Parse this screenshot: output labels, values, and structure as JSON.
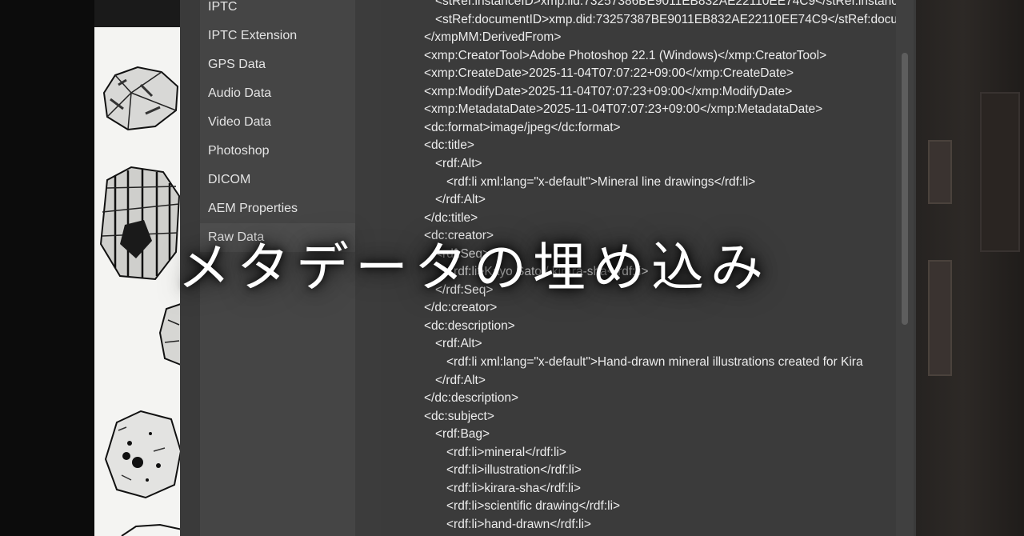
{
  "caption": "メタデータの埋め込み",
  "sidebar": {
    "items": [
      {
        "label": "IPTC"
      },
      {
        "label": "IPTC Extension"
      },
      {
        "label": "GPS Data"
      },
      {
        "label": "Audio Data"
      },
      {
        "label": "Video Data"
      },
      {
        "label": "Photoshop"
      },
      {
        "label": "DICOM"
      },
      {
        "label": "AEM Properties"
      },
      {
        "label": "Raw Data",
        "selected": true
      }
    ]
  },
  "xml": {
    "lines": [
      {
        "indent": 1,
        "text": "<stRef:instanceID>xmp.iid:73257386BE9011EB832AE22110EE74C9</stRef:instanc"
      },
      {
        "indent": 1,
        "text": "<stRef:documentID>xmp.did:73257387BE9011EB832AE22110EE74C9</stRef:docu"
      },
      {
        "indent": 0,
        "text": "</xmpMM:DerivedFrom>"
      },
      {
        "indent": 0,
        "text": "<xmp:CreatorTool>Adobe Photoshop 22.1 (Windows)</xmp:CreatorTool>"
      },
      {
        "indent": 0,
        "text": "<xmp:CreateDate>2025-11-04T07:07:22+09:00</xmp:CreateDate>"
      },
      {
        "indent": 0,
        "text": "<xmp:ModifyDate>2025-11-04T07:07:23+09:00</xmp:ModifyDate>"
      },
      {
        "indent": 0,
        "text": "<xmp:MetadataDate>2025-11-04T07:07:23+09:00</xmp:MetadataDate>"
      },
      {
        "indent": 0,
        "text": "<dc:format>image/jpeg</dc:format>"
      },
      {
        "indent": 0,
        "text": "<dc:title>"
      },
      {
        "indent": 1,
        "text": "<rdf:Alt>"
      },
      {
        "indent": 2,
        "text": "<rdf:li xml:lang=\"x-default\">Mineral line drawings</rdf:li>"
      },
      {
        "indent": 1,
        "text": "</rdf:Alt>"
      },
      {
        "indent": 0,
        "text": "</dc:title>"
      },
      {
        "indent": 0,
        "text": "<dc:creator>"
      },
      {
        "indent": 1,
        "text": "<rdf:Seq>"
      },
      {
        "indent": 2,
        "text": "<rdf:li>Kayo Sato / kirara-sha</rdf:li>"
      },
      {
        "indent": 1,
        "text": "</rdf:Seq>"
      },
      {
        "indent": 0,
        "text": "</dc:creator>"
      },
      {
        "indent": 0,
        "text": "<dc:description>"
      },
      {
        "indent": 1,
        "text": "<rdf:Alt>"
      },
      {
        "indent": 2,
        "text": "<rdf:li xml:lang=\"x-default\">Hand-drawn mineral illustrations created for Kira"
      },
      {
        "indent": 1,
        "text": "</rdf:Alt>"
      },
      {
        "indent": 0,
        "text": "</dc:description>"
      },
      {
        "indent": 0,
        "text": "<dc:subject>"
      },
      {
        "indent": 1,
        "text": "<rdf:Bag>"
      },
      {
        "indent": 2,
        "text": "<rdf:li>mineral</rdf:li>"
      },
      {
        "indent": 2,
        "text": "<rdf:li>illustration</rdf:li>"
      },
      {
        "indent": 2,
        "text": "<rdf:li>kirara-sha</rdf:li>"
      },
      {
        "indent": 2,
        "text": "<rdf:li>scientific drawing</rdf:li>"
      },
      {
        "indent": 2,
        "text": "<rdf:li>hand-drawn</rdf:li>"
      }
    ]
  }
}
